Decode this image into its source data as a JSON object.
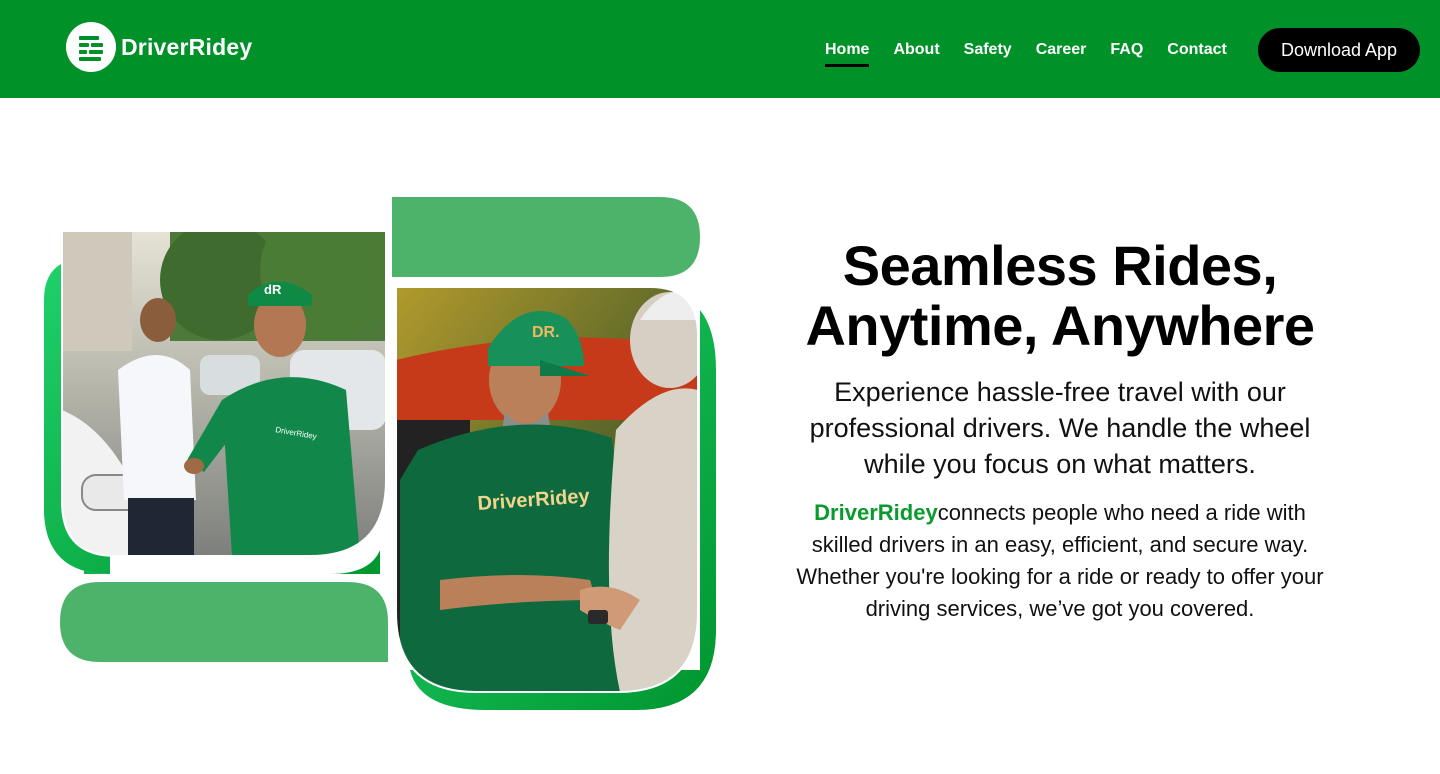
{
  "brand": {
    "name": "DriverRidey",
    "logo_icon": "steering-lines-icon",
    "color": "#009128",
    "accent": "#0a9a2e"
  },
  "nav": {
    "items": [
      {
        "label": "Home",
        "active": true
      },
      {
        "label": "About"
      },
      {
        "label": "Safety"
      },
      {
        "label": "Career"
      },
      {
        "label": "FAQ"
      },
      {
        "label": "Contact"
      }
    ],
    "cta": "Download App"
  },
  "hero": {
    "title_line1": "Seamless Rides,",
    "title_line2": "Anytime, Anywhere",
    "subtitle": "Experience hassle-free travel with our professional drivers. We handle the wheel while you focus on what matters.",
    "body_brand": "DriverRidey",
    "body_text": "connects people who need a ride with skilled drivers in an easy, efficient, and secure way. Whether you're looking for a ride or ready to offer your driving services, we’ve got you covered.",
    "photo1_cap_text": "dR",
    "photo1_shirt_text": "DriverRidey",
    "photo2_cap_text": "DR.",
    "photo2_shirt_text": "DriverRidey"
  }
}
